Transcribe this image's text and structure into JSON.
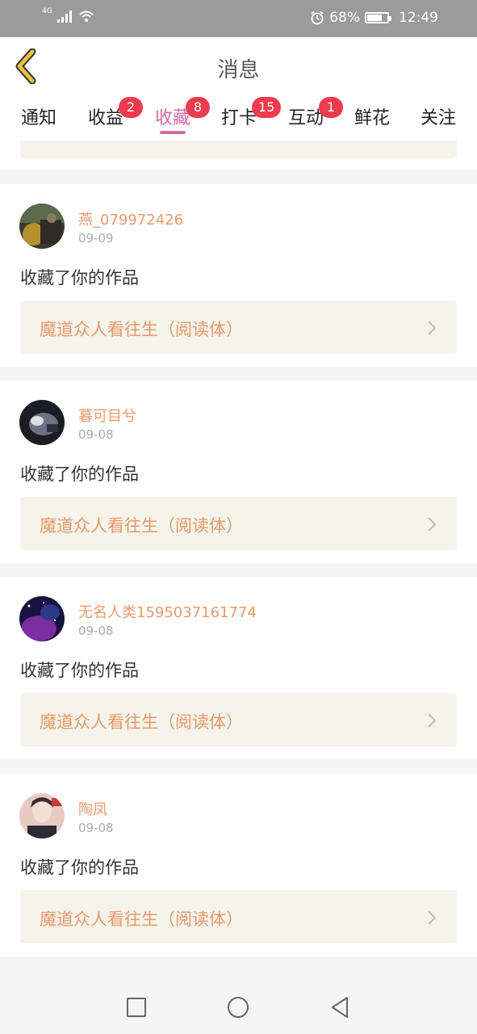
{
  "status_bar": {
    "network": "4G",
    "battery": "68%",
    "time": "12:49",
    "battery_level": 0.68,
    "icons": [
      "signal-icon",
      "wifi-icon",
      "alarm-icon",
      "battery-icon"
    ]
  },
  "header": {
    "title": "消息",
    "back_icon": "chevron-left-icon"
  },
  "tabs": [
    {
      "label": "通知",
      "badge": ""
    },
    {
      "label": "收益",
      "badge": "2"
    },
    {
      "label": "收藏",
      "badge": "8",
      "active": true
    },
    {
      "label": "打卡",
      "badge": "15"
    },
    {
      "label": "互动",
      "badge": "1"
    },
    {
      "label": "鲜花",
      "badge": ""
    },
    {
      "label": "关注",
      "badge": ""
    }
  ],
  "messages": [
    {
      "name": "燕_079972426",
      "date": "09-09",
      "action": "收藏了你的作品",
      "work_title": "魔道众人看往生（阅读体）"
    },
    {
      "name": "暮可目兮",
      "date": "09-08",
      "action": "收藏了你的作品",
      "work_title": "魔道众人看往生（阅读体）"
    },
    {
      "name": "无名人类1595037161774",
      "date": "09-08",
      "action": "收藏了你的作品",
      "work_title": "魔道众人看往生（阅读体）"
    },
    {
      "name": "陶凤",
      "date": "09-08",
      "action": "收藏了你的作品",
      "work_title": "魔道众人看往生（阅读体）"
    }
  ],
  "colors": {
    "accent": "#d66aa3",
    "badge": "#ef3b4f",
    "name": "#e79a6b",
    "back_icon": "#e8c43a"
  },
  "navbar": {
    "icons": [
      "recent-apps-icon",
      "home-icon",
      "back-icon"
    ]
  }
}
